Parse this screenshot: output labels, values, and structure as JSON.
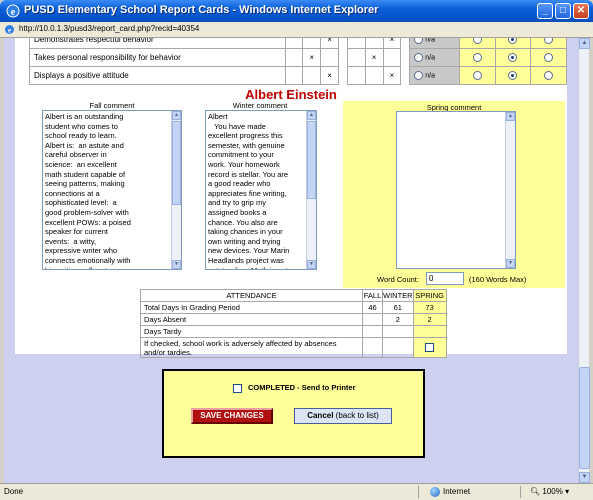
{
  "window": {
    "title": "PUSD Elementary School Report Cards - Windows Internet Explorer",
    "minimize_glyph": "_",
    "maximize_glyph": "□",
    "close_glyph": "✕"
  },
  "address": {
    "url": "http://10.0.1.3/pusd3/report_card.php?recid=40354"
  },
  "behavior_rows": [
    {
      "label": "Demonstrates respectful behavior",
      "marks": [
        "",
        "",
        "×",
        "",
        "",
        "×"
      ],
      "na": "n/a",
      "selected": 2
    },
    {
      "label": "Takes personal responsibility for behavior",
      "marks": [
        "",
        "×",
        "",
        "",
        "×",
        ""
      ],
      "na": "n/a",
      "selected": 2
    },
    {
      "label": "Displays a positive attitude",
      "marks": [
        "",
        "",
        "×",
        "",
        "",
        "×"
      ],
      "na": "n/a",
      "selected": 2
    }
  ],
  "student": {
    "name": "Albert Einstein"
  },
  "comments": {
    "fall_label": "Fall comment",
    "winter_label": "Winter comment",
    "spring_label": "Spring comment",
    "fall_text": "Albert is an outstanding\nstudent who comes to\nschool ready to learn.\nAlbert is:  an astute and\ncareful observer in\nscience:  an excellent\nmath student capable of\nseeing patterns, making\nconnections at a\nsophisticated level:  a\ngood problem-solver with\nexcellent POWs: a poised\nspeaker for current\nevents:  a witty,\nexpressive writer who\nconnects emotionally with\nhis writing: a fluent\nreader of fiction and\nnonfiction: a super\nspeller: an artist!",
    "winter_text": "Albert\n   You have made\nexcellent progress this\nsemester, with genuine\ncommitment to your\nwork. Your homework\nrecord is stellar. You are\na good reader who\nappreciates fine writing,\nand try to grip my\nassigned books a\nchance. You also are\ntaking chances in your\nown writing and trying\nnew devices. Your Marin\nHeadlands project was\noutstanding. Math is not\nyour easiest subject, but\nyou have persevered.\nYour math confidence",
    "spring_text": "",
    "word_count_label": "Word Count:",
    "word_count_value": "0",
    "word_count_max": "(160 Words Max)"
  },
  "attendance": {
    "header": "ATTENDANCE",
    "columns": [
      "FALL",
      "WINTER",
      "SPRING"
    ],
    "rows": [
      {
        "label": "Total Days In Grading Period",
        "fall": "46",
        "winter": "61",
        "spring": "73"
      },
      {
        "label": "Days Absent",
        "fall": "",
        "winter": "2",
        "spring": "2"
      },
      {
        "label": "Days Tardy",
        "fall": "",
        "winter": "",
        "spring": ""
      }
    ],
    "note": "If checked, school work is adversely affected by absences and/or tardies."
  },
  "actions": {
    "completed_label": "COMPLETED - Send to Printer",
    "save_label": "SAVE CHANGES",
    "cancel_bold": "Cancel",
    "cancel_rest": " (back to list)"
  },
  "status": {
    "done": "Done",
    "zone": "Internet",
    "zoom": "100%"
  },
  "colors": {
    "titlebar": "#0a5fd8",
    "name_red": "#c00000",
    "highlight_yellow": "#ffff99",
    "save_red": "#b01010",
    "page_bg": "#cdd0ee"
  }
}
